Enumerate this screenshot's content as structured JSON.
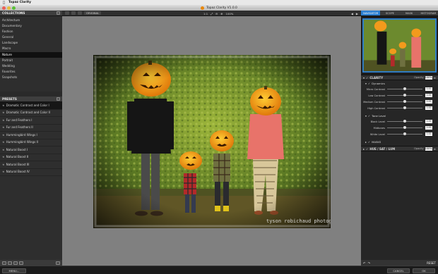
{
  "menubar": {
    "apple": "",
    "app_name": "Topaz Clarity"
  },
  "window": {
    "title": "Topaz Clarity V1.0.0"
  },
  "collections": {
    "header": "COLLECTIONS",
    "items": [
      "Architecture",
      "Documentary",
      "Fashion",
      "General",
      "Landscape",
      "Macro",
      "Nature",
      "Portrait",
      "Wedding",
      "Favorites",
      "Snapshots"
    ],
    "selected_index": 6
  },
  "presets": {
    "header": "PRESETS",
    "items": [
      "Dramatic Contrast and Color I",
      "Dramatic Contrast and Color II",
      "Fur and Feathers I",
      "Fur and Feathers II",
      "Hummingbird Wings I",
      "Hummingbird Wings II",
      "Natural Boost I",
      "Natural Boost II",
      "Natural Boost III",
      "Natural Boost IV"
    ],
    "selected_index": 0
  },
  "toolbar": {
    "original": "ORIGINAL",
    "zoom_label": "100%"
  },
  "photo": {
    "watermark": "tyson robichaud photography"
  },
  "right_tabs": [
    "NAVIGATOR",
    "SCOPE",
    "MASK",
    "HISTOGRAM"
  ],
  "right_tab_active": 0,
  "clarity": {
    "title": "CLARITY",
    "opacity_label": "Opacity",
    "opacity_value": "100%",
    "dynamics_label": "Dynamics",
    "dynamics_rows": [
      {
        "label": "Micro Contrast",
        "value": "0.00",
        "pos": 0.5
      },
      {
        "label": "Low Contrast",
        "value": "0.00",
        "pos": 0.5
      },
      {
        "label": "Medium Contrast",
        "value": "0.00",
        "pos": 0.5
      },
      {
        "label": "High Contrast",
        "value": "0.00",
        "pos": 0.5
      }
    ],
    "tone_label": "Tone Level",
    "tone_rows": [
      {
        "label": "Black Level",
        "value": "0.00",
        "pos": 0.5
      },
      {
        "label": "Midtones",
        "value": "0.00",
        "pos": 0.5
      },
      {
        "label": "White Level",
        "value": "0.00",
        "pos": 0.5
      }
    ],
    "masks_label": "MASKS"
  },
  "hsl": {
    "title": "HUE / SAT / LUM",
    "opacity_label": "Opacity",
    "opacity_value": "100%"
  },
  "right_footer": {
    "reset": "RESET"
  },
  "bottom": {
    "menu": "MENU...",
    "cancel": "CANCEL",
    "ok": "OK"
  },
  "colors": {
    "accent": "#2d7fd1",
    "logo": "#e8870c"
  }
}
